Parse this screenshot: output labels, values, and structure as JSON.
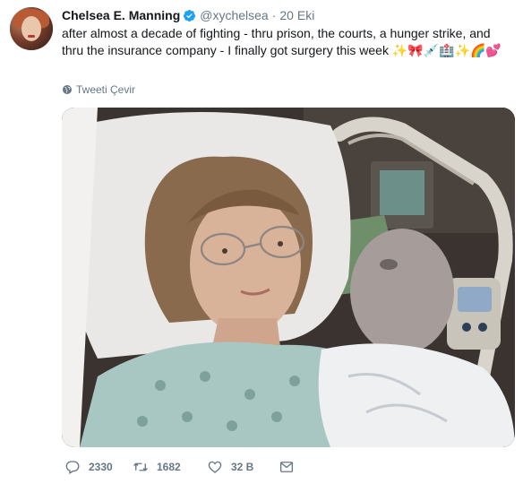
{
  "tweet": {
    "author_name": "Chelsea E. Manning",
    "author_handle": "@xychelsea",
    "date": "20 Eki",
    "text": "after almost a decade of fighting - thru prison, the courts, a hunger strike, and thru the insurance company - I finally got surgery this week ✨🎀💉🏥✨🌈💕",
    "translate_label": "Tweeti Çevir",
    "verified": true
  },
  "actions": {
    "replies": "2330",
    "retweets": "1682",
    "likes": "32 B"
  },
  "colors": {
    "verified_blue": "#1da1f2",
    "muted_text": "#657786",
    "text": "#14171a"
  },
  "icons": [
    "verified-badge-icon",
    "globe-icon",
    "reply-icon",
    "retweet-icon",
    "like-icon",
    "direct-message-icon"
  ]
}
